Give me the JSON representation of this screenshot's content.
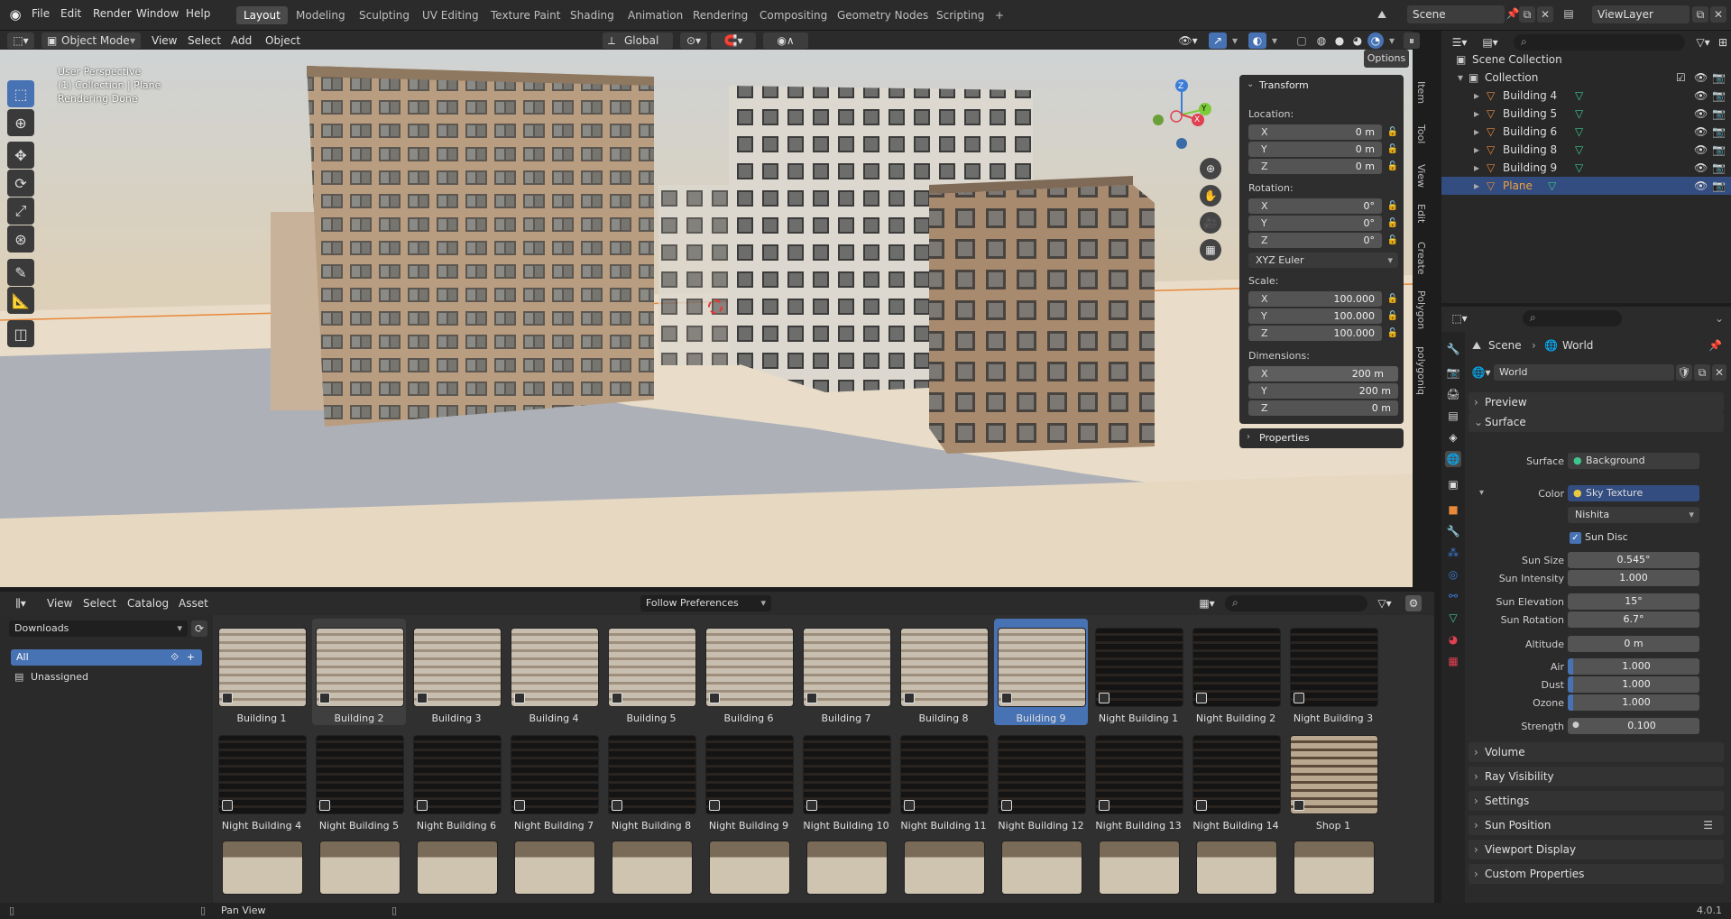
{
  "topbar": {
    "menus": [
      "File",
      "Edit",
      "Render",
      "Window",
      "Help"
    ],
    "workspaces": [
      "Layout",
      "Modeling",
      "Sculpting",
      "UV Editing",
      "Texture Paint",
      "Shading",
      "Animation",
      "Rendering",
      "Compositing",
      "Geometry Nodes",
      "Scripting"
    ],
    "active_workspace": "Layout",
    "add_tab": "+",
    "scene": "Scene",
    "view_layer": "ViewLayer"
  },
  "viewport_header": {
    "mode": "Object Mode",
    "menus": [
      "View",
      "Select",
      "Add",
      "Object"
    ],
    "transform_orientation": "Global",
    "options": "Options"
  },
  "viewport": {
    "overlay_lines": [
      "User Perspective",
      "(1) Collection | Plane",
      "Rendering Done"
    ],
    "gizmo": {
      "z": "Z",
      "x": "X",
      "y": "Y"
    }
  },
  "sidebar_tabs": [
    "Item",
    "Tool",
    "View",
    "Edit",
    "Create",
    "Polygon",
    "polygoniq"
  ],
  "npanel": {
    "transform_title": "Transform",
    "location_label": "Location:",
    "location": [
      {
        "k": "X",
        "v": "0 m"
      },
      {
        "k": "Y",
        "v": "0 m"
      },
      {
        "k": "Z",
        "v": "0 m"
      }
    ],
    "rotation_label": "Rotation:",
    "rotation": [
      {
        "k": "X",
        "v": "0°"
      },
      {
        "k": "Y",
        "v": "0°"
      },
      {
        "k": "Z",
        "v": "0°"
      }
    ],
    "rotation_mode": "XYZ Euler",
    "scale_label": "Scale:",
    "scale": [
      {
        "k": "X",
        "v": "100.000"
      },
      {
        "k": "Y",
        "v": "100.000"
      },
      {
        "k": "Z",
        "v": "100.000"
      }
    ],
    "dimensions_label": "Dimensions:",
    "dimensions": [
      {
        "k": "X",
        "v": "200 m"
      },
      {
        "k": "Y",
        "v": "200 m"
      },
      {
        "k": "Z",
        "v": "0 m"
      }
    ],
    "properties_title": "Properties"
  },
  "outliner": {
    "root": "Scene Collection",
    "collection": "Collection",
    "items": [
      "Building 4",
      "Building 5",
      "Building 6",
      "Building 8",
      "Building 9",
      "Plane"
    ],
    "selected": "Plane"
  },
  "properties": {
    "breadcrumb": [
      "Scene",
      "World"
    ],
    "world_name": "World",
    "sections_top": [
      "Preview",
      "Surface"
    ],
    "surface_label": "Surface",
    "surface_value": "Background",
    "color_label": "Color",
    "color_value": "Sky Texture",
    "sky_type": "Nishita",
    "sun_disc": "Sun Disc",
    "fields": [
      {
        "label": "Sun Size",
        "value": "0.545°"
      },
      {
        "label": "Sun Intensity",
        "value": "1.000"
      },
      {
        "label": "Sun Elevation",
        "value": "15°"
      },
      {
        "label": "Sun Rotation",
        "value": "6.7°"
      },
      {
        "label": "Altitude",
        "value": "0 m"
      },
      {
        "label": "Air",
        "value": "1.000"
      },
      {
        "label": "Dust",
        "value": "1.000"
      },
      {
        "label": "Ozone",
        "value": "1.000"
      },
      {
        "label": "Strength",
        "value": "0.100"
      }
    ],
    "sections_bottom": [
      "Volume",
      "Ray Visibility",
      "Settings",
      "Sun Position",
      "Viewport Display",
      "Custom Properties"
    ]
  },
  "asset_browser": {
    "menus": [
      "View",
      "Select",
      "Catalog",
      "Asset"
    ],
    "library": "Downloads",
    "import_method": "Follow Preferences",
    "catalogs": [
      "All",
      "Unassigned"
    ],
    "row1": [
      "Building 1",
      "Building 2",
      "Building 3",
      "Building 4",
      "Building 5",
      "Building 6",
      "Building 7",
      "Building 8",
      "Building 9",
      "Night Building 1",
      "Night Building 2",
      "Night Building 3"
    ],
    "row2": [
      "Night Building 4",
      "Night Building 5",
      "Night Building 6",
      "Night Building 7",
      "Night Building 8",
      "Night Building 9",
      "Night Building 10",
      "Night Building 11",
      "Night Building 12",
      "Night Building 13",
      "Night Building 14",
      "Shop 1"
    ],
    "selected": "Building 9",
    "hover": "Building 2"
  },
  "statusbar": {
    "hint": "Pan View",
    "version": "4.0.1"
  },
  "colors": {
    "accent": "#4772b3",
    "select": "#334d80",
    "object_orange": "#e8883a",
    "mesh_green": "#3ec68c"
  }
}
